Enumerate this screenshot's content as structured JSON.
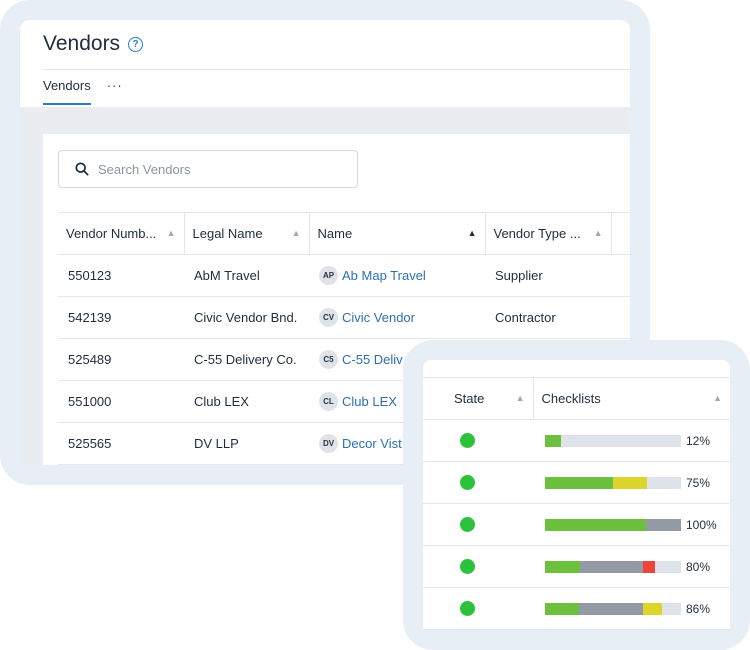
{
  "header": {
    "title": "Vendors"
  },
  "tabs": [
    {
      "label": "Vendors"
    }
  ],
  "tab_more": "···",
  "search": {
    "placeholder": "Search Vendors"
  },
  "table": {
    "columns": [
      "Vendor Numb...",
      "Legal Name",
      "Name",
      "Vendor Type ..."
    ],
    "rows": [
      {
        "number": "550123",
        "legal": "AbM Travel",
        "initials": "AP",
        "name": "Ab Map Travel",
        "type": "Supplier"
      },
      {
        "number": "542139",
        "legal": "Civic Vendor Bnd.",
        "initials": "CV",
        "name": "Civic Vendor",
        "type": "Contractor"
      },
      {
        "number": "525489",
        "legal": "C-55 Delivery Co.",
        "initials": "C5",
        "name": "C-55 Deliv",
        "type": ""
      },
      {
        "number": "551000",
        "legal": "Club LEX",
        "initials": "CL",
        "name": "Club LEX",
        "type": ""
      },
      {
        "number": "525565",
        "legal": "DV LLP",
        "initials": "DV",
        "name": "Decor Vist",
        "type": ""
      }
    ]
  },
  "overlay": {
    "columns": [
      "State",
      "Checklists"
    ],
    "colors": {
      "green": "#6cc03e",
      "yellow": "#dcd62c",
      "gray": "#939aa3",
      "red": "#f0433a",
      "track": "#dde3e9",
      "state_green": "#2dc23c"
    },
    "rows": [
      {
        "percent": "12%",
        "segments": [
          {
            "color": "green",
            "fraction": 0.12
          }
        ]
      },
      {
        "percent": "75%",
        "segments": [
          {
            "color": "green",
            "fraction": 0.5
          },
          {
            "color": "yellow",
            "fraction": 0.25
          }
        ]
      },
      {
        "percent": "100%",
        "segments": [
          {
            "color": "green",
            "fraction": 0.74
          },
          {
            "color": "gray",
            "fraction": 0.26
          }
        ]
      },
      {
        "percent": "80%",
        "segments": [
          {
            "color": "green",
            "fraction": 0.26
          },
          {
            "color": "gray",
            "fraction": 0.46
          },
          {
            "color": "red",
            "fraction": 0.09
          }
        ]
      },
      {
        "percent": "86%",
        "segments": [
          {
            "color": "green",
            "fraction": 0.25
          },
          {
            "color": "gray",
            "fraction": 0.47
          },
          {
            "color": "yellow",
            "fraction": 0.14
          }
        ]
      }
    ]
  }
}
